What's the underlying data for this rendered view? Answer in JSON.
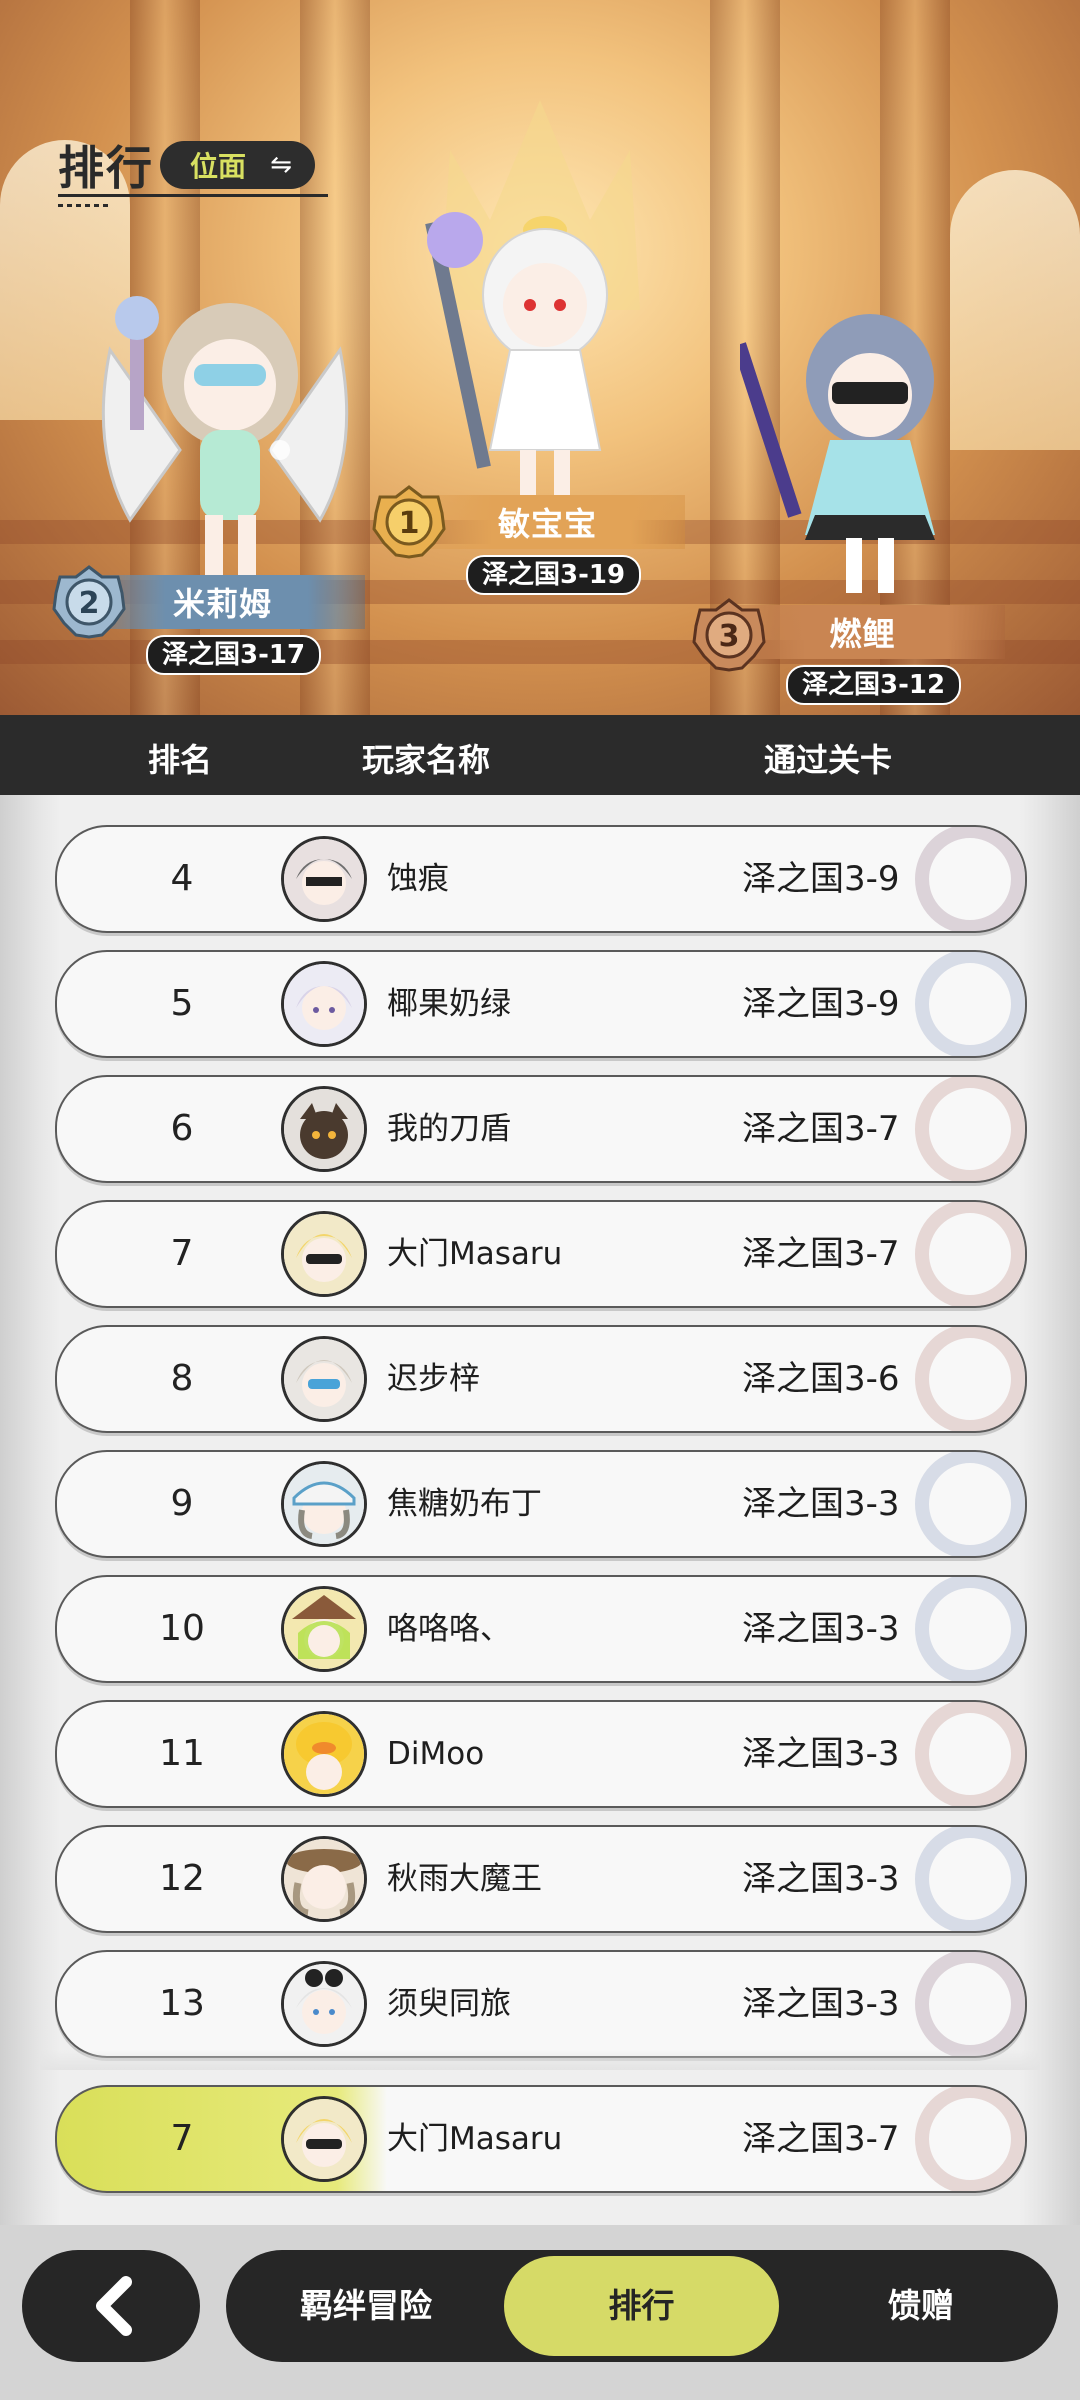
{
  "header": {
    "title": "排行",
    "plane_label": "位面",
    "swap_icon": "swap-arrows-icon"
  },
  "podium": [
    {
      "rank": 1,
      "name": "敏宝宝",
      "stage": "泽之国3-19"
    },
    {
      "rank": 2,
      "name": "米莉姆",
      "stage": "泽之国3-17"
    },
    {
      "rank": 3,
      "name": "燃鲤",
      "stage": "泽之国3-12"
    }
  ],
  "columns": {
    "rank": "排名",
    "player": "玩家名称",
    "stage": "通过关卡"
  },
  "rows": [
    {
      "rank": "4",
      "name": "蚀痕",
      "stage": "泽之国3-9"
    },
    {
      "rank": "5",
      "name": "椰果奶绿",
      "stage": "泽之国3-9"
    },
    {
      "rank": "6",
      "name": "我的刀盾",
      "stage": "泽之国3-7"
    },
    {
      "rank": "7",
      "name": "大门Masaru",
      "stage": "泽之国3-7"
    },
    {
      "rank": "8",
      "name": "迟步梓",
      "stage": "泽之国3-6"
    },
    {
      "rank": "9",
      "name": "焦糖奶布丁",
      "stage": "泽之国3-3"
    },
    {
      "rank": "10",
      "name": "咯咯咯、",
      "stage": "泽之国3-3"
    },
    {
      "rank": "11",
      "name": "DiMoo",
      "stage": "泽之国3-3"
    },
    {
      "rank": "12",
      "name": "秋雨大魔王",
      "stage": "泽之国3-3"
    },
    {
      "rank": "13",
      "name": "须臾同旅",
      "stage": "泽之国3-3"
    }
  ],
  "self_row": {
    "rank": "7",
    "name": "大门Masaru",
    "stage": "泽之国3-7"
  },
  "nav": {
    "back_icon": "chevron-left-icon",
    "items": [
      "羁绊冒险",
      "排行",
      "馈赠"
    ],
    "active": "排行"
  },
  "colors": {
    "accent": "#d6da67",
    "dark": "#262626",
    "header_bar": "#2b2b2b"
  }
}
